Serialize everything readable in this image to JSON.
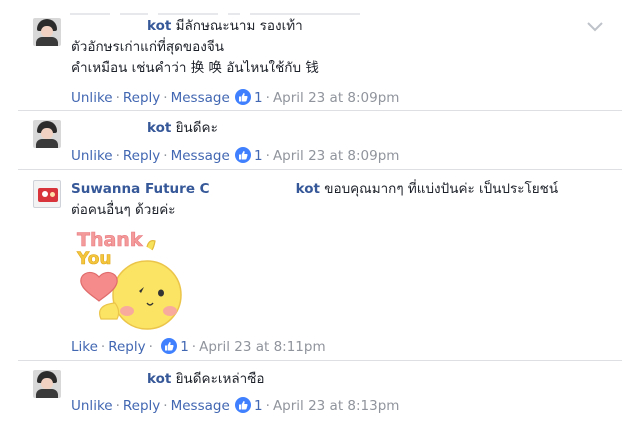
{
  "comments": [
    {
      "name_visible": "kot",
      "text_line1": "มีลักษณะนาม รองเท้า",
      "text_line2": "ตัวอักษรเก่าแก่ที่สุดของจีน",
      "text_line3": "คำเหมือน เช่นคำว่า 换 唤 อันไหนใช้กับ 钱",
      "actions": {
        "like": "Unlike",
        "reply": "Reply",
        "message": "Message",
        "reactions": "1",
        "timestamp": "April 23 at 8:09pm"
      }
    },
    {
      "name_visible": "kot",
      "text_line1": "ยินดีคะ",
      "actions": {
        "like": "Unlike",
        "reply": "Reply",
        "message": "Message",
        "reactions": "1",
        "timestamp": "April 23 at 8:09pm"
      }
    },
    {
      "name_visible_start": "Suwanna Future C",
      "name_visible_end": "kot",
      "text_line1": "ขอบคุณมากๆ ที่แบ่งปันค่ะ เป็นประโยชน์",
      "text_line2": "ต่อคนอื่นๆ ด้วยค่ะ",
      "sticker_text_1": "Thank",
      "sticker_text_2": "You",
      "actions": {
        "like": "Like",
        "reply": "Reply",
        "reactions": "1",
        "timestamp": "April 23 at 8:11pm"
      }
    },
    {
      "name_visible": "kot",
      "text_line1": "ยินดีคะเหล่าซือ",
      "actions": {
        "like": "Unlike",
        "reply": "Reply",
        "message": "Message",
        "reactions": "1",
        "timestamp": "April 23 at 8:13pm"
      }
    }
  ],
  "colors": {
    "link": "#4267b2",
    "name": "#365899",
    "meta": "#90949c",
    "like_badge": "#4080ff"
  }
}
